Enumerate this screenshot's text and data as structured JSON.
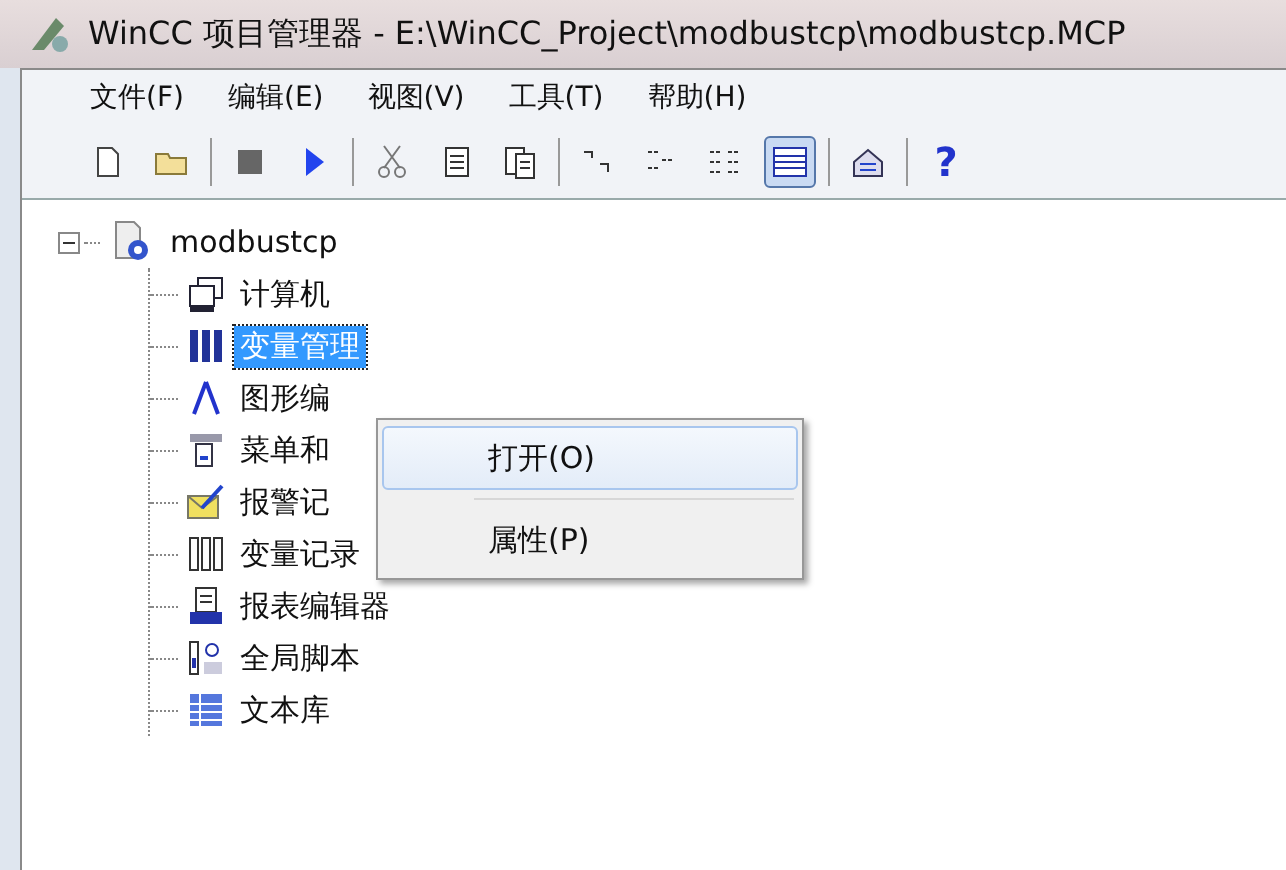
{
  "window": {
    "title": "WinCC 项目管理器 - E:\\WinCC_Project\\modbustcp\\modbustcp.MCP"
  },
  "menu": [
    {
      "label": "文件(F)"
    },
    {
      "label": "编辑(E)"
    },
    {
      "label": "视图(V)"
    },
    {
      "label": "工具(T)"
    },
    {
      "label": "帮助(H)"
    }
  ],
  "toolbar": [
    {
      "kind": "new",
      "selected": false
    },
    {
      "kind": "open",
      "selected": false
    },
    {
      "kind": "sep"
    },
    {
      "kind": "stop",
      "selected": false
    },
    {
      "kind": "play",
      "selected": false
    },
    {
      "kind": "sep"
    },
    {
      "kind": "cut",
      "selected": false
    },
    {
      "kind": "copy",
      "selected": false
    },
    {
      "kind": "paste",
      "selected": false
    },
    {
      "kind": "sep"
    },
    {
      "kind": "largeicons",
      "selected": false
    },
    {
      "kind": "smallicons",
      "selected": false
    },
    {
      "kind": "list",
      "selected": false
    },
    {
      "kind": "details",
      "selected": true
    },
    {
      "kind": "sep"
    },
    {
      "kind": "properties",
      "selected": false
    },
    {
      "kind": "sep"
    },
    {
      "kind": "help",
      "label": "?",
      "selected": false
    }
  ],
  "tree": {
    "root": {
      "label": "modbustcp",
      "expanded": true,
      "children": [
        {
          "label": "计算机",
          "kind": "computer",
          "selected": false
        },
        {
          "label": "变量管理",
          "kind": "tags",
          "selected": true
        },
        {
          "label": "图形编",
          "kind": "graphics",
          "selected": false
        },
        {
          "label": "菜单和",
          "kind": "menus",
          "selected": false
        },
        {
          "label": "报警记",
          "kind": "alarms",
          "selected": false
        },
        {
          "label": "变量记录",
          "kind": "taglog",
          "selected": false
        },
        {
          "label": "报表编辑器",
          "kind": "report",
          "selected": false
        },
        {
          "label": "全局脚本",
          "kind": "script",
          "selected": false
        },
        {
          "label": "文本库",
          "kind": "textlib",
          "selected": false
        }
      ]
    }
  },
  "context_menu": [
    {
      "label": "打开(O)",
      "selected": true
    },
    {
      "label": "属性(P)",
      "selected": false
    }
  ]
}
